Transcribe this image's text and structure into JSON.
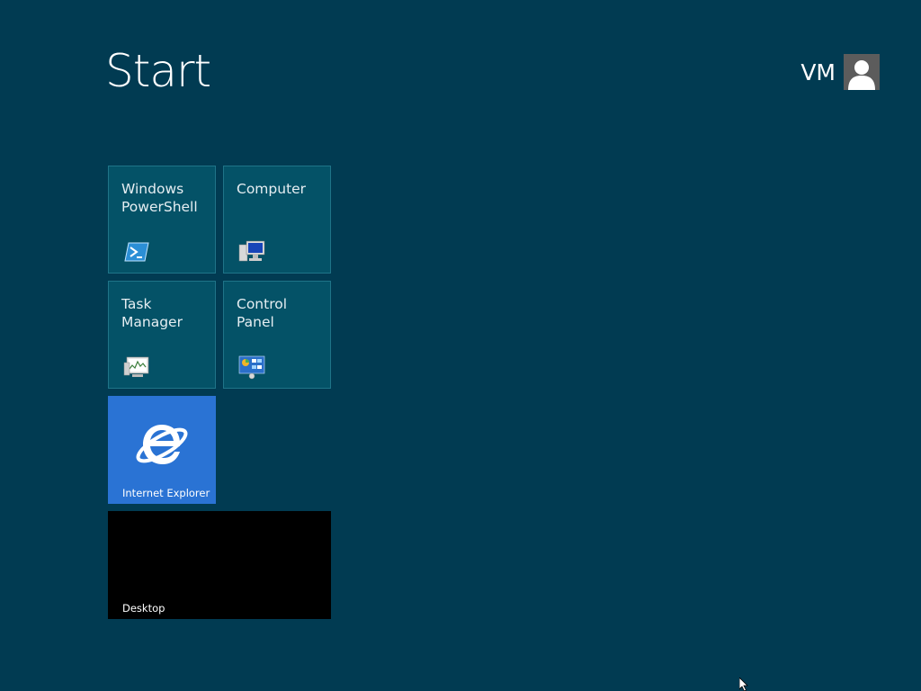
{
  "header": {
    "title": "Start",
    "user_name": "VM"
  },
  "tiles": [
    {
      "label": "Windows PowerShell",
      "icon": "powershell-icon"
    },
    {
      "label": "Computer",
      "icon": "computer-icon"
    },
    {
      "label": "Task Manager",
      "icon": "task-manager-icon"
    },
    {
      "label": "Control Panel",
      "icon": "control-panel-icon"
    },
    {
      "label": "Internet Explorer",
      "icon": "internet-explorer-icon"
    },
    {
      "label": "Desktop",
      "icon": ""
    }
  ],
  "colors": {
    "background": "#013b52",
    "tile": "#045267",
    "tile_border": "#1f7488",
    "ie_tile": "#2a73d4",
    "desktop_tile": "#000000"
  }
}
